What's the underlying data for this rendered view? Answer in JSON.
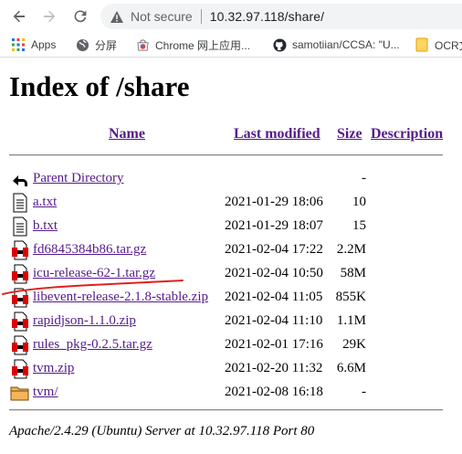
{
  "browser": {
    "security_status": "Not secure",
    "url": "10.32.97.118/share/",
    "bookmarks": [
      {
        "label": "Apps",
        "icon": "apps-grid-icon"
      },
      {
        "label": "分屏",
        "icon": "globe-icon"
      },
      {
        "label": "Chrome 网上应用...",
        "icon": "chrome-webstore-icon"
      },
      {
        "label": "samotiian/CCSA: \"U...",
        "icon": "github-icon"
      },
      {
        "label": "OCR文",
        "icon": "folder-icon"
      }
    ]
  },
  "page": {
    "title": "Index of /share",
    "columns": {
      "name": "Name",
      "last_modified": "Last modified",
      "size": "Size",
      "description": "Description"
    },
    "parent": {
      "name": "Parent Directory",
      "date": "",
      "size": "-"
    },
    "files": [
      {
        "name": "a.txt",
        "date": "2021-01-29 18:06",
        "size": "10",
        "icon": "text-file-icon"
      },
      {
        "name": "b.txt",
        "date": "2021-01-29 18:07",
        "size": "15",
        "icon": "text-file-icon"
      },
      {
        "name": "fd6845384b86.tar.gz",
        "date": "2021-02-04 17:22",
        "size": "2.2M",
        "icon": "archive-file-icon"
      },
      {
        "name": "icu-release-62-1.tar.gz",
        "date": "2021-02-04 10:50",
        "size": "58M",
        "icon": "archive-file-icon"
      },
      {
        "name": "libevent-release-2.1.8-stable.zip",
        "date": "2021-02-04 11:05",
        "size": "855K",
        "icon": "archive-file-icon"
      },
      {
        "name": "rapidjson-1.1.0.zip",
        "date": "2021-02-04 11:10",
        "size": "1.1M",
        "icon": "archive-file-icon"
      },
      {
        "name": "rules_pkg-0.2.5.tar.gz",
        "date": "2021-02-01 17:16",
        "size": "29K",
        "icon": "archive-file-icon"
      },
      {
        "name": "tvm.zip",
        "date": "2021-02-20 11:32",
        "size": "6.6M",
        "icon": "archive-file-icon"
      },
      {
        "name": "tvm/",
        "date": "2021-02-08 16:18",
        "size": "-",
        "icon": "folder-icon"
      }
    ],
    "server_signature": "Apache/2.4.29 (Ubuntu) Server at 10.32.97.118 Port 80"
  },
  "colors": {
    "visited_link": "#551a8b",
    "annotation_stroke": "#e0201e"
  }
}
